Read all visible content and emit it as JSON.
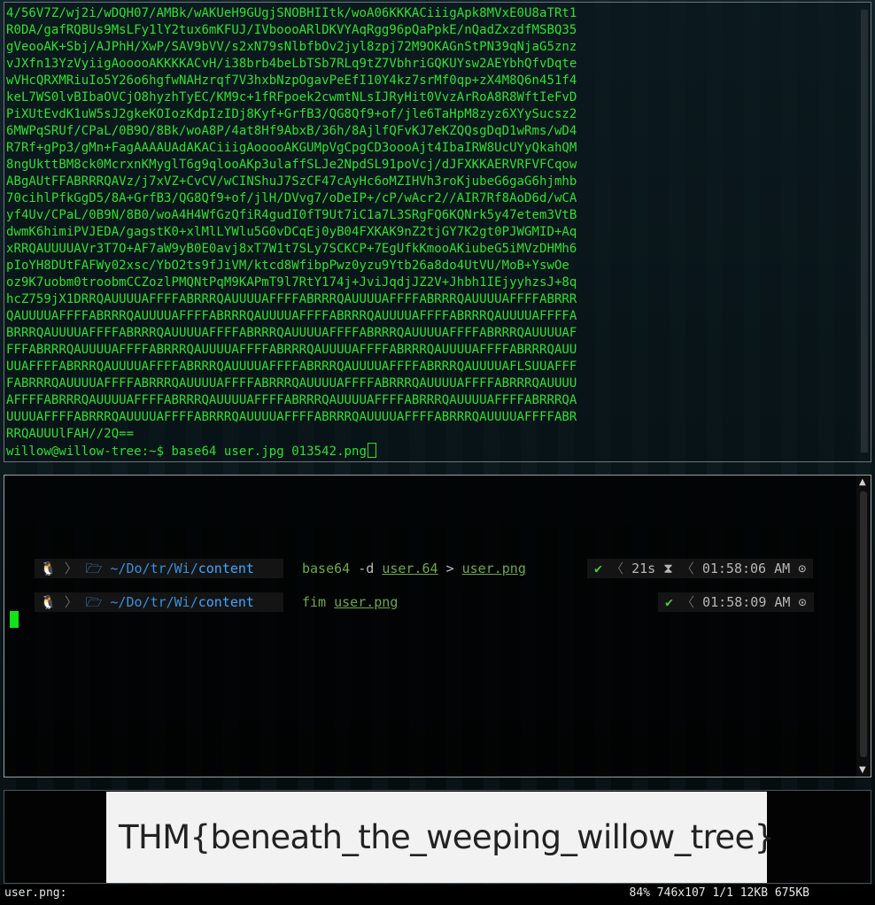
{
  "terminal1": {
    "lines": [
      "4/56V7Z/wj2i/wDQH07/AMBk/wAKUeH9GUgjSNOBHIItk/woA06KKKACiiigApk8MVxE0U8aTRt1",
      "R0DA/gafRQBUs9MsLFy1lY2tux6mKFUJ/IVboooARlDKVYAqRgg96pQaPpkE/nQadZxzdfMSBQ35",
      "gVeooAK+Sbj/AJPhH/XwP/SAV9bVV/s2xN79sNlbfbOv2jyl8zpj72M9OKAGnStPN39qNjaG5znz",
      "vJXfn13YzVyiigAooooAKKKKACvH/i38brb4beLbTSb7RLq9tZ7VbhriGQKUYsw2AEYbhQfvDqte",
      "wVHcQRXMRiuIo5Y26o6hgfwNAHzrqf7V3hxbNzpOgavPeEfI10Y4kz7srMf0qp+zX4M8Q6n451f4",
      "keL7WS0lvBIbaOVCjO8hyzhTyEC/KM9c+1fRFpoek2cwmtNLsIJRyHit0VvzArRoA8R8WftIeFvD",
      "PiXUtEvdK1uW5sJ2gkeKOIozKdpIzIDj8Kyf+GrfB3/QG8Qf9+of/jle6TaHpM8zyz6XYySucsz2",
      "6MWPqSRUf/CPaL/0B9O/8Bk/woA8P/4at8Hf9AbxB/36h/8AjlfQFvKJ7eKZQQsgDqD1wRms/wD4",
      "R7Rf+gPp3/gMn+FagAAAAUAdAKACiiigAooooAKGUMpVgCpgCD3oooAjt4IbaIRW8UcUYyQkahQM",
      "8ngUkttBM8ck0McrxnKMyglT6g9qlooAKp3ulaffSLJe2NpdSL91poVcj/dJFXKKAERVRFVFCqow",
      "ABgAUtFFABRRRQAVz/j7xVZ+CvCV/wCINShuJ7SzCF47cAyHc6oMZIHVh3roKjubeG6gaG6hjmhb",
      "70cihlPfkGgD5/8A+GrfB3/QG8Qf9+of/jlH/DVvg7/oDeIP+/cP/wAcr2//AIR7Rf8AoD6d/wCA",
      "yf4Uv/CPaL/0B9N/8B0/woA4H4WfGzQfiR4gudI0fT9Ut7iC1a7L3SRgFQ6KQNrk5y47etem3VtB",
      "dwmK6himiPVJEDA/gagstK0+xlMlLYWlu5G0vDCqEj0yB04FXKAK9nZ2tjGY7K2gt0PJWGMID+Aq",
      "xRRQAUUUUAVr3T7O+AF7aW9yB0E0avj8xT7W1t7SLy7SCKCP+7EgUfkKmooAKiubeG5iMVzDHMh6",
      "pIoYH8DUtFAFWy02xsc/YbO2ts9fJiVM/ktcd8WfibpPwz0yzu9Ytb26a8do4UtVU/MoB+YswOe",
      "oz9K7uobm0troobmCCZozlPMQNtPqM9KAPmT9l7RtY174j+JviJqdjJZ2V+Jhbh1IEjyyhzsJ+8q",
      "hcZ759jX1DRRQAUUUUAFFFFABRRRQAUUUUAFFFFABRRRQAUUUUAFFFFABRRRQAUUUUAFFFFABRRR",
      "QAUUUUAFFFFABRRRQAUUUUAFFFFABRRRQAUUUUAFFFFABRRRQAUUUUAFFFFABRRRQAUUUUAFFFFA",
      "BRRRQAUUUUAFFFFABRRRQAUUUUAFFFFABRRRQAUUUUAFFFFABRRRQAUUUUAFFFFABRRRQAUUUUAF",
      "FFFABRRRQAUUUUAFFFFABRRRQAUUUUAFFFFABRRRQAUUUUAFFFFABRRRQAUUUUAFFFFABRRRQAUU",
      "UUAFFFFABRRRQAUUUUAFFFFABRRRQAUUUUAFFFFABRRRQAUUUUAFFFFABRRRQAUUUUAFLSUUAFFF",
      "FABRRRQAUUUUAFFFFABRRRQAUUUUAFFFFABRRRQAUUUUAFFFFABRRRQAUUUUAFFFFABRRRQAUUUU",
      "AFFFFABRRRQAUUUUAFFFFABRRRQAUUUUAFFFFABRRRQAUUUUAFFFFABRRRQAUUUUAFFFFABRRRQA",
      "UUUUAFFFFABRRRQAUUUUAFFFFABRRRQAUUUUAFFFFABRRRQAUUUUAFFFFABRRRQAUUUUAFFFFABR",
      "RRQAUUUlFAH//2Q=="
    ],
    "prompt": "willow@willow-tree:~$ base64 user.jpg 013542.png"
  },
  "terminal2": {
    "rows": [
      {
        "os_icon": "🐧",
        "folder_icon": "🗁",
        "path_prefix": "~/",
        "path_dim1": "Do",
        "path_sep1": "/",
        "path_dim2": "tr",
        "path_sep2": "/",
        "path_dim3": "Wi",
        "path_sep3": "/",
        "path_main": "content",
        "cmd_prog": "base64",
        "cmd_flag": " -d ",
        "cmd_arg": "user.64",
        "cmd_op": " > ",
        "cmd_file": "user.png",
        "ok_icon": "✔",
        "duration": "21s",
        "hourglass_icon": "⧗",
        "time": "01:58:06 AM",
        "clock_icon": "⊙"
      },
      {
        "os_icon": "🐧",
        "folder_icon": "🗁",
        "path_prefix": "~/",
        "path_dim1": "Do",
        "path_sep1": "/",
        "path_dim2": "tr",
        "path_sep2": "/",
        "path_dim3": "Wi",
        "path_sep3": "/",
        "path_main": "content",
        "cmd_prog": "fim",
        "cmd_file": "user.png",
        "ok_icon": "✔",
        "time": "01:58:09 AM",
        "clock_icon": "⊙"
      }
    ],
    "sep_glyph": "〉",
    "sep_left_glyph": "〈"
  },
  "viewer": {
    "image_text": "THM{beneath_the_weeping_willow_tree}",
    "status_left": "user.png:",
    "status_right": "84% 746x107 1/1 12KB 675KB"
  },
  "colors": {
    "terminal_green": "#2fe02f",
    "path_blue": "#3fa8ff",
    "cmd_green": "#6ea84a",
    "ok_green": "#59c33b"
  }
}
